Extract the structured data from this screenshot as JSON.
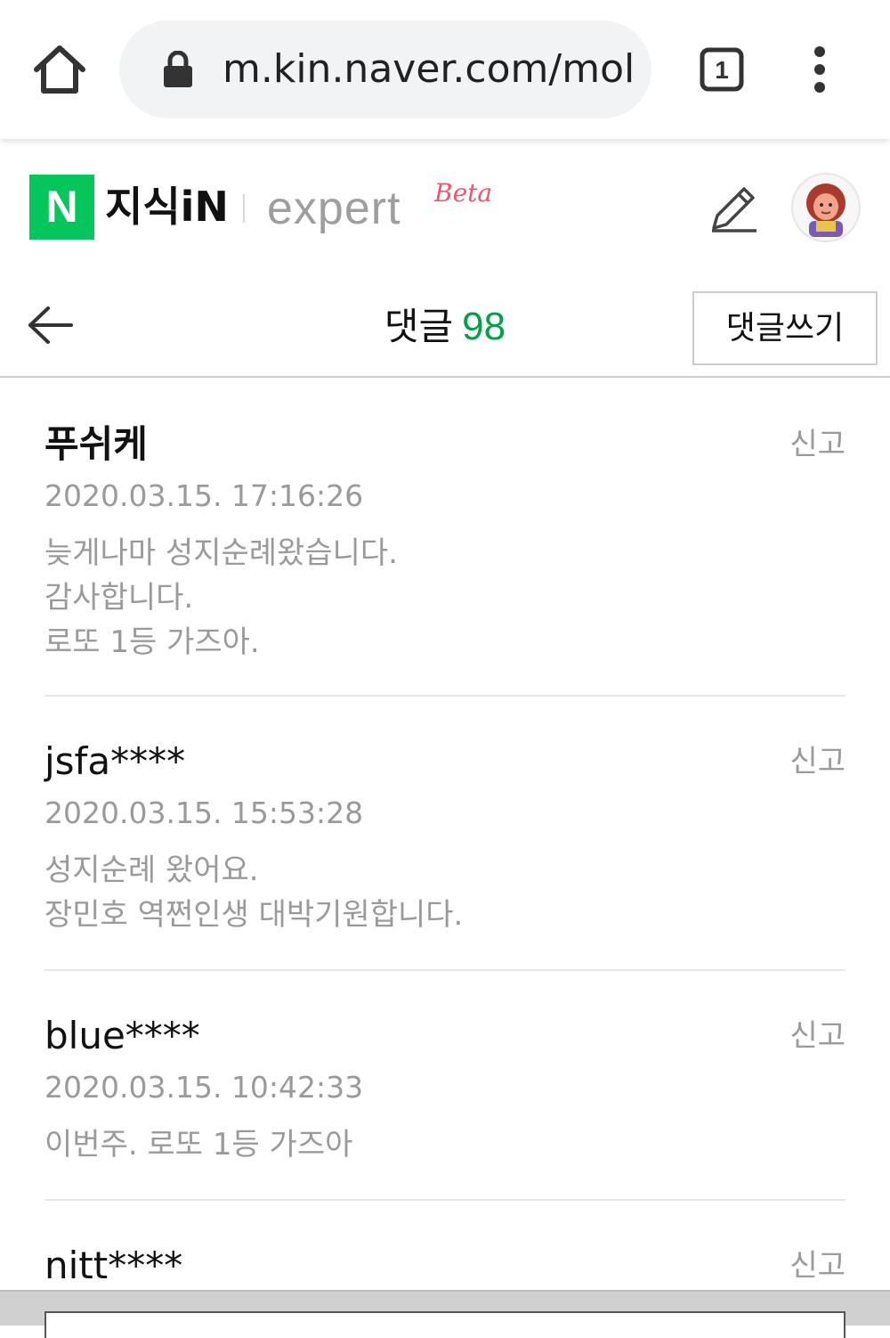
{
  "browser": {
    "url": "m.kin.naver.com/mol",
    "tab_count": "1"
  },
  "header": {
    "logo_letter": "N",
    "brand_name": "지식iN",
    "expert_text": "expert",
    "beta_text": "Beta"
  },
  "subheader": {
    "title": "댓글",
    "count": "98",
    "write_button": "댓글쓰기"
  },
  "comments": [
    {
      "author": "푸쉬케",
      "date": "2020.03.15. 17:16:26",
      "report": "신고",
      "lines": [
        "늦게나마 성지순례왔습니다.",
        "감사합니다.",
        "로또 1등 가즈아."
      ]
    },
    {
      "author": "jsfa****",
      "date": "2020.03.15. 15:53:28",
      "report": "신고",
      "lines": [
        "성지순례 왔어요.",
        "장민호 역쩐인생 대박기원합니다."
      ]
    },
    {
      "author": "blue****",
      "date": "2020.03.15. 10:42:33",
      "report": "신고",
      "lines": [
        "이번주. 로또 1등 가즈아"
      ]
    },
    {
      "author": "nitt****",
      "report": "신고"
    }
  ],
  "colors": {
    "naver_green": "#03c75a",
    "count_green": "#03a04c",
    "beta_pink": "#f0566a"
  }
}
